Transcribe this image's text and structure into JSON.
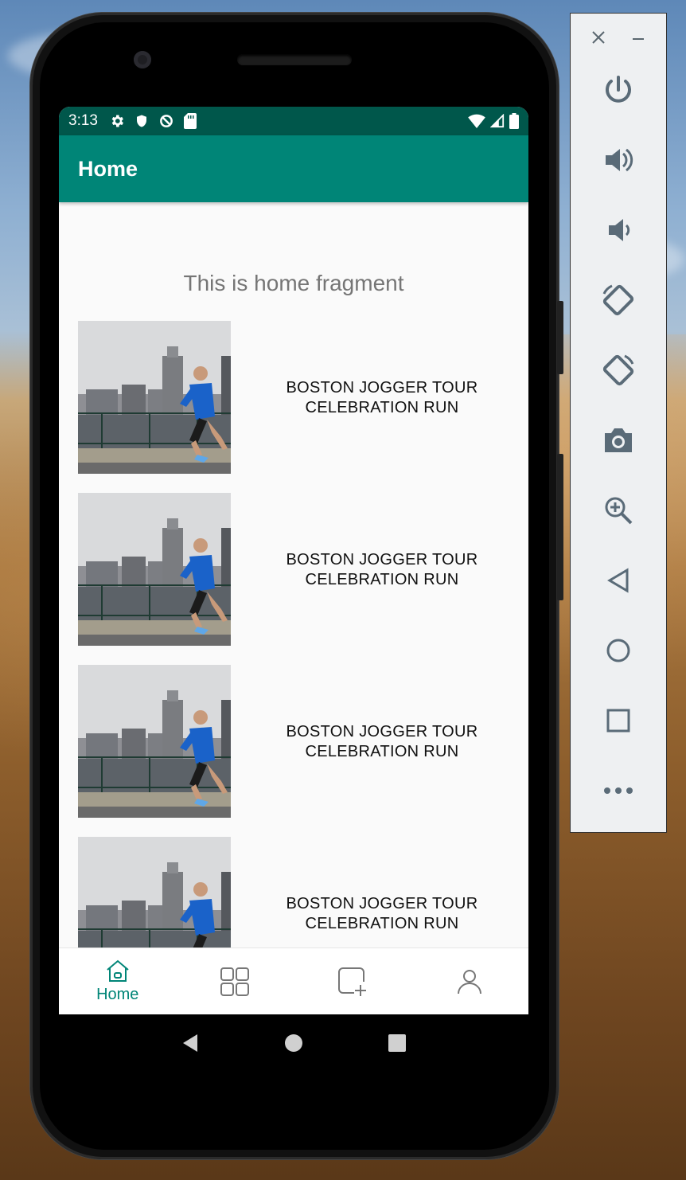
{
  "status_bar": {
    "time": "3:13"
  },
  "app_bar": {
    "title": "Home"
  },
  "home": {
    "fragment_text": "This is home fragment"
  },
  "list": {
    "items": [
      {
        "title_line1": "BOSTON JOGGER TOUR",
        "title_line2": "CELEBRATION RUN"
      },
      {
        "title_line1": "BOSTON JOGGER TOUR",
        "title_line2": "CELEBRATION RUN"
      },
      {
        "title_line1": "BOSTON JOGGER TOUR",
        "title_line2": "CELEBRATION RUN"
      },
      {
        "title_line1": "BOSTON JOGGER TOUR",
        "title_line2": "CELEBRATION RUN"
      }
    ]
  },
  "bottom_nav": {
    "items": [
      {
        "label": "Home",
        "icon": "home-icon",
        "active": true
      },
      {
        "label": "",
        "icon": "grid-icon",
        "active": false
      },
      {
        "label": "",
        "icon": "add-square-icon",
        "active": false
      },
      {
        "label": "",
        "icon": "person-icon",
        "active": false
      }
    ]
  },
  "emulator_panel": {
    "tools": [
      "close-icon",
      "minimize-icon",
      "power-icon",
      "volume-up-icon",
      "volume-down-icon",
      "rotate-left-icon",
      "rotate-right-icon",
      "camera-icon",
      "zoom-icon",
      "back-icon",
      "home-icon",
      "overview-icon",
      "more-icon"
    ]
  },
  "colors": {
    "primary": "#008577",
    "primary_dark": "#00574b",
    "screen_bg": "#fafafa"
  }
}
